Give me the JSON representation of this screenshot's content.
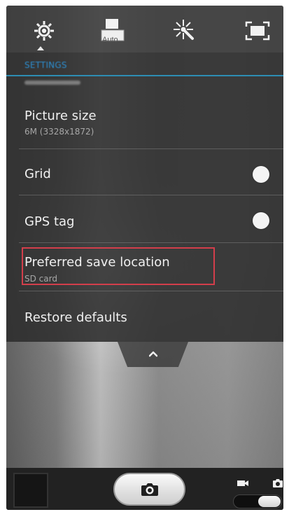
{
  "toolbar": {
    "settings_icon": "gear-icon",
    "auto_label": "Auto",
    "effects_icon": "sparkle-icon",
    "screen_icon": "screen-mode-icon"
  },
  "settings": {
    "title": "SETTINGS",
    "items": [
      {
        "label": "Picture size",
        "value": "6M (3328x1872)"
      },
      {
        "label": "Grid"
      },
      {
        "label": "GPS tag"
      },
      {
        "label": "Preferred save location",
        "value": "SD card"
      },
      {
        "label": "Restore defaults"
      }
    ]
  },
  "colors": {
    "accent": "#2d8db3",
    "highlight": "#d33e4b"
  }
}
